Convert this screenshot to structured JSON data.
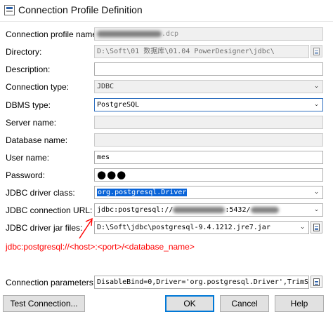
{
  "window": {
    "title": "Connection Profile Definition"
  },
  "form": {
    "profile_name": {
      "label": "Connection profile name:",
      "value_suffix": ".dcp"
    },
    "directory": {
      "label": "Directory:",
      "value": "D:\\Soft\\01 数据库\\01.04 PowerDesigner\\jdbc\\"
    },
    "description": {
      "label": "Description:",
      "value": ""
    },
    "connection_type": {
      "label": "Connection type:",
      "value": "JDBC"
    },
    "dbms_type": {
      "label": "DBMS type:",
      "value": "PostgreSQL"
    },
    "server_name": {
      "label": "Server name:",
      "value": ""
    },
    "database_name": {
      "label": "Database name:",
      "value": ""
    },
    "user_name": {
      "label": "User name:",
      "value": "mes"
    },
    "password": {
      "label": "Password:",
      "value": "●●●"
    },
    "jdbc_driver_class": {
      "label": "JDBC driver class:",
      "value": "org.postgresql.Driver"
    },
    "jdbc_connection_url": {
      "label": "JDBC connection URL:",
      "value_prefix": "jdbc:postgresql://",
      "value_middle": ":5432/"
    },
    "jdbc_driver_jar": {
      "label": "JDBC driver jar files:",
      "value": "D:\\Soft\\jdbc\\postgresql-9.4.1212.jre7.jar"
    },
    "connection_parameters": {
      "label": "Connection parameters:",
      "value": "DisableBind=0,Driver='org.postgresql.Driver',TrimSpa"
    }
  },
  "annotation": {
    "text": "jdbc:postgresql://<host>:<port>/<database_name>",
    "color": "#ff0000"
  },
  "buttons": {
    "test_connection": "Test Connection...",
    "ok": "OK",
    "cancel": "Cancel",
    "help": "Help"
  },
  "icons": {
    "app": "window-app-icon",
    "browse": "document-browse-icon",
    "dropdown": "chevron-down-icon"
  },
  "colors": {
    "selection": "#0a64d8",
    "focus_border": "#0078d7"
  }
}
